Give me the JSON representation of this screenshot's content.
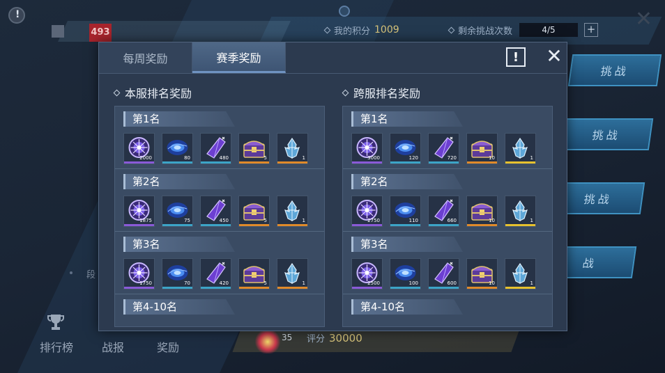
{
  "background": {
    "rank_badge": "493",
    "my_score_label": "我的积分",
    "my_score_value": "1009",
    "remaining_label": "剩余挑战次数",
    "remaining_value": "4/5",
    "plus": "+",
    "challenge_buttons": [
      "挑战",
      "挑战",
      "挑战",
      "战"
    ],
    "nav": [
      "排行榜",
      "战报",
      "奖励"
    ],
    "segment_fragment": "段",
    "bottom_level": "35",
    "bottom_score_label": "评分",
    "bottom_score_value": "30000"
  },
  "modal": {
    "tabs": [
      {
        "label": "每周奖励",
        "active": false
      },
      {
        "label": "赛季奖励",
        "active": true
      }
    ],
    "info_symbol": "!",
    "close_symbol": "✕",
    "sections": [
      {
        "title": "本服排名奖励",
        "ranks": [
          {
            "label": "第1名",
            "items": [
              {
                "icon": "purple-orb-icon",
                "qty": "2000",
                "bar": "#8a5ad8"
              },
              {
                "icon": "blue-galaxy-icon",
                "qty": "80",
                "bar": "#3ca4c7"
              },
              {
                "icon": "purple-crystal-icon",
                "qty": "480",
                "bar": "#3ca4c7"
              },
              {
                "icon": "treasure-chest-icon",
                "qty": "5",
                "bar": "#e08a2a"
              },
              {
                "icon": "ice-shard-icon",
                "qty": "1",
                "bar": "#e08a2a"
              }
            ]
          },
          {
            "label": "第2名",
            "items": [
              {
                "icon": "purple-orb-icon",
                "qty": "1875",
                "bar": "#8a5ad8"
              },
              {
                "icon": "blue-galaxy-icon",
                "qty": "75",
                "bar": "#3ca4c7"
              },
              {
                "icon": "purple-crystal-icon",
                "qty": "450",
                "bar": "#3ca4c7"
              },
              {
                "icon": "treasure-chest-icon",
                "qty": "5",
                "bar": "#e08a2a"
              },
              {
                "icon": "ice-shard-icon",
                "qty": "1",
                "bar": "#e08a2a"
              }
            ]
          },
          {
            "label": "第3名",
            "items": [
              {
                "icon": "purple-orb-icon",
                "qty": "1750",
                "bar": "#8a5ad8"
              },
              {
                "icon": "blue-galaxy-icon",
                "qty": "70",
                "bar": "#3ca4c7"
              },
              {
                "icon": "purple-crystal-icon",
                "qty": "420",
                "bar": "#3ca4c7"
              },
              {
                "icon": "treasure-chest-icon",
                "qty": "5",
                "bar": "#e08a2a"
              },
              {
                "icon": "ice-shard-icon",
                "qty": "1",
                "bar": "#e08a2a"
              }
            ]
          },
          {
            "label": "第4-10名",
            "items": []
          }
        ]
      },
      {
        "title": "跨服排名奖励",
        "ranks": [
          {
            "label": "第1名",
            "items": [
              {
                "icon": "purple-orb-icon",
                "qty": "3000",
                "bar": "#8a5ad8"
              },
              {
                "icon": "blue-galaxy-icon",
                "qty": "120",
                "bar": "#3ca4c7"
              },
              {
                "icon": "purple-crystal-icon",
                "qty": "720",
                "bar": "#3ca4c7"
              },
              {
                "icon": "treasure-chest-icon",
                "qty": "10",
                "bar": "#e08a2a"
              },
              {
                "icon": "ice-shard-icon",
                "qty": "1",
                "bar": "#e6c12e"
              }
            ]
          },
          {
            "label": "第2名",
            "items": [
              {
                "icon": "purple-orb-icon",
                "qty": "2750",
                "bar": "#8a5ad8"
              },
              {
                "icon": "blue-galaxy-icon",
                "qty": "110",
                "bar": "#3ca4c7"
              },
              {
                "icon": "purple-crystal-icon",
                "qty": "660",
                "bar": "#3ca4c7"
              },
              {
                "icon": "treasure-chest-icon",
                "qty": "10",
                "bar": "#e08a2a"
              },
              {
                "icon": "ice-shard-icon",
                "qty": "1",
                "bar": "#e6c12e"
              }
            ]
          },
          {
            "label": "第3名",
            "items": [
              {
                "icon": "purple-orb-icon",
                "qty": "2500",
                "bar": "#8a5ad8"
              },
              {
                "icon": "blue-galaxy-icon",
                "qty": "100",
                "bar": "#3ca4c7"
              },
              {
                "icon": "purple-crystal-icon",
                "qty": "600",
                "bar": "#3ca4c7"
              },
              {
                "icon": "treasure-chest-icon",
                "qty": "10",
                "bar": "#e08a2a"
              },
              {
                "icon": "ice-shard-icon",
                "qty": "1",
                "bar": "#e6c12e"
              }
            ]
          },
          {
            "label": "第4-10名",
            "items": []
          }
        ]
      }
    ]
  }
}
